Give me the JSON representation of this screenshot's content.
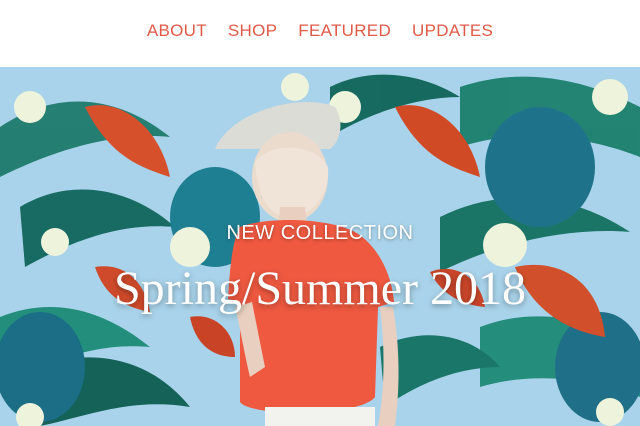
{
  "nav": {
    "items": [
      {
        "label": "ABOUT"
      },
      {
        "label": "SHOP"
      },
      {
        "label": "FEATURED"
      },
      {
        "label": "UPDATES"
      }
    ]
  },
  "hero": {
    "kicker": "NEW COLLECTION",
    "headline": "Spring/Summer 2018",
    "image": "tropical-pattern-model-photo"
  },
  "colors": {
    "nav_text": "#e05a48",
    "hero_bg": "#a9d3ea",
    "headline_text": "#ffffff"
  }
}
